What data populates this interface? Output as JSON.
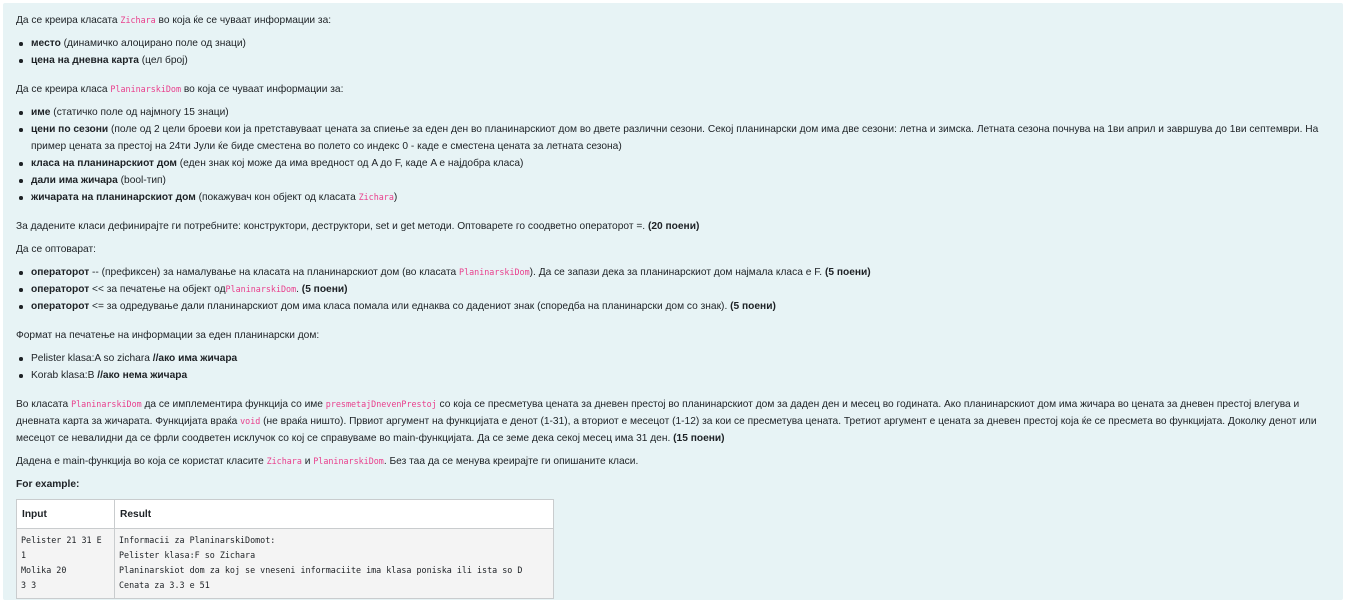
{
  "zichara_intro": {
    "pre": "Да се креира класата ",
    "code": "Zichara",
    "post": " во која ќе се чуваат информации за:"
  },
  "zichara_fields": [
    {
      "bold": "место",
      "rest": " (динамичко алоцирано поле од знаци)"
    },
    {
      "bold": "цена на дневна карта",
      "rest": " (цел број)"
    }
  ],
  "dom_intro": {
    "pre": "Да се креира класа ",
    "code": "PlaninarskiDom",
    "post": " во која се чуваат информации за:"
  },
  "dom_fields": {
    "f1": {
      "bold": "име",
      "rest": " (статичко поле од најмногу 15 знаци)"
    },
    "f2": {
      "bold": "цени по сезони",
      "rest": " (поле од 2 цели броеви кои ја претставуваат цената за спиење за еден ден во планинарскиот дом во двете различни сезони. Секој планинарски дом има две сезони: летна и зимска. Летната сезона почнува на 1ви април и завршува до 1ви септември. На пример цената за престој на 24ти Јули ќе биде сместена во полето со индекс 0 - каде е сместена цената за летната сезона)"
    },
    "f3": {
      "bold": "класа на планинарскиот дом",
      "rest": " (еден знак кој може да има вредност од A до F, каде A е најдобра класа)"
    },
    "f4": {
      "bold": "дали има жичара",
      "rest": " (bool-тип)"
    },
    "f5": {
      "bold": "жичарата на планинарскиот дом",
      "rest": " (покажувач кон објект од класата ",
      "code": "Zichara",
      "post": ")"
    }
  },
  "methods_text": {
    "text": "За дадените класи дефинирајте ги потребните: конструктори, деструктори, set и get методи. Оптоварете го соодветно операторот =. ",
    "points": "(20 поени)"
  },
  "overload_intro": "Да се оптоварат:",
  "operators": {
    "o1": {
      "bold": "операторот",
      "pre": " -- (префиксен) за намалување на класата на планинарскиот дом (во класата ",
      "code": "PlaninarskiDom",
      "post": "). Да се запази дека за планинарскиот дом најмала класа е F. ",
      "points": "(5 поени)"
    },
    "o2": {
      "bold": "операторот",
      "pre": " << за печатење на објект од",
      "code": "PlaninarskiDom",
      "post": ". ",
      "points": "(5 поени)"
    },
    "o3": {
      "bold": "операторот",
      "pre": " <= за одредување дали планинарскиот дом има класа помала или еднаква со дадениот знак (споредба на планинарски дом со знак). ",
      "points": "(5 поени)"
    }
  },
  "print_format_intro": "Формат на печатење на информации за еден планинарски дом:",
  "print_format": {
    "p1": {
      "text": "Pelister klasa:A so zichara ",
      "bold": "//ако има жичара"
    },
    "p2": {
      "text": "Korab klasa:B ",
      "bold": "//ако нема жичара"
    }
  },
  "function_text": {
    "pre1": "Во класата ",
    "code1": "PlaninarskiDom",
    "mid1": " да се имплементира функција со име ",
    "code2": "presmetajDnevenPrestoj",
    "mid2": " со која се пресметува цената за дневен престој во планинарскиот дом за даден ден и месец во годината. Ако планинарскиот дом има жичара во цената за дневен престој влегува и дневната карта за жичарата. Функцијата враќа ",
    "code3": "void",
    "mid3": " (не враќа ништо). Првиот аргумент на функцијата е денот (1-31), а вториот е месецот (1-12) за кои се пресметува цената. Третиот аргумент е цената за дневен престој која ќе се пресмета во функцијата. Доколку денот или месецот се невалидни да се фрли соодветен исклучок со кој се справуваме во main-функцијата. Да се земе дека секој месец има 31 ден. ",
    "points": "(15 поени)"
  },
  "main_text": {
    "pre": "Дадена е main-функција во која се користат класите ",
    "code1": "Zichara",
    "mid": " и ",
    "code2": "PlaninarskiDom",
    "post": ". Без таа да се менува креирајте ги опишаните класи."
  },
  "example_label": "For example:",
  "example_table": {
    "headers": [
      "Input",
      "Result"
    ],
    "input": "Pelister 21 31 E\n1\nMolika 20\n3 3",
    "result": "Informacii za PlaninarskiDomot:\nPelister klasa:F so Zichara\nPlaninarskiot dom za koj se vneseni informaciite ima klasa poniska ili ista so D\nCenata za 3.3 e 51"
  }
}
